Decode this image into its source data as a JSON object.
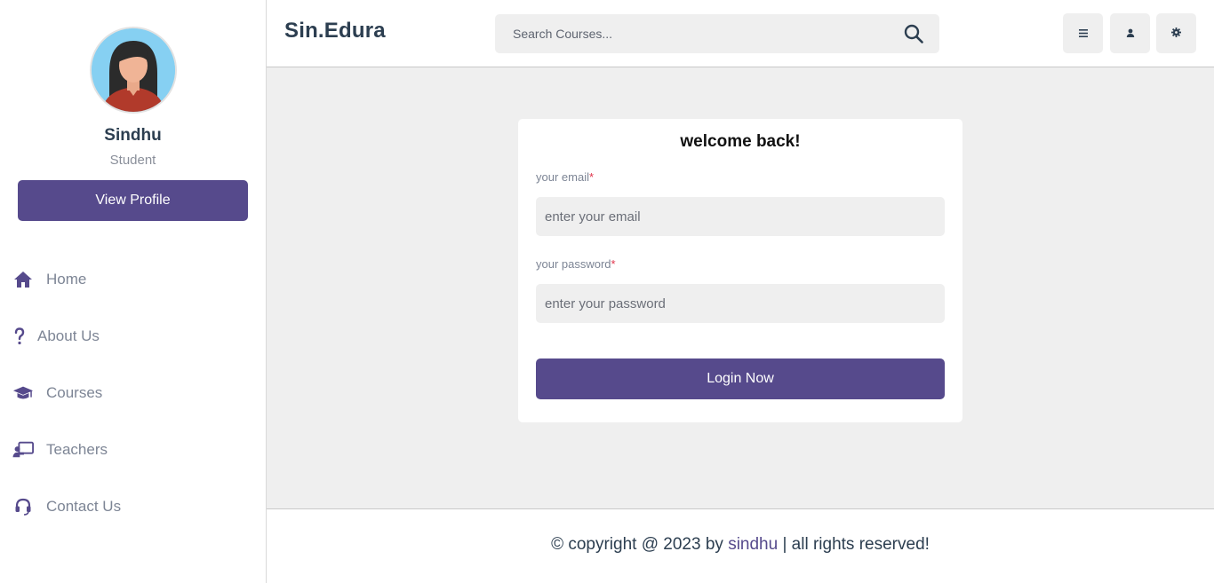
{
  "sidebar": {
    "profile": {
      "name": "Sindhu",
      "role": "Student",
      "view_profile_label": "View Profile"
    },
    "nav": [
      {
        "label": "Home",
        "icon": "home-icon"
      },
      {
        "label": "About Us",
        "icon": "question-icon"
      },
      {
        "label": "Courses",
        "icon": "graduation-cap-icon"
      },
      {
        "label": "Teachers",
        "icon": "chalkboard-teacher-icon"
      },
      {
        "label": "Contact Us",
        "icon": "headset-icon"
      }
    ]
  },
  "header": {
    "logo": "Sin.Edura",
    "search": {
      "placeholder": "Search Courses...",
      "icon": "search-icon"
    },
    "buttons": [
      {
        "icon": "menu-icon"
      },
      {
        "icon": "user-icon"
      },
      {
        "icon": "gear-icon"
      }
    ]
  },
  "login": {
    "title": "welcome back!",
    "email_label": "your email",
    "email_placeholder": "enter your email",
    "password_label": "your password",
    "password_placeholder": "enter your password",
    "required_marker": "*",
    "submit_label": "Login Now"
  },
  "footer": {
    "prefix": "© copyright @ 2023 by ",
    "author": "sindhu",
    "suffix": " | all rights reserved!"
  },
  "colors": {
    "accent": "#564a8c",
    "background": "#efefef",
    "required": "#e0344b",
    "text_dark": "#2c3e50",
    "text_muted": "#7d8595"
  }
}
